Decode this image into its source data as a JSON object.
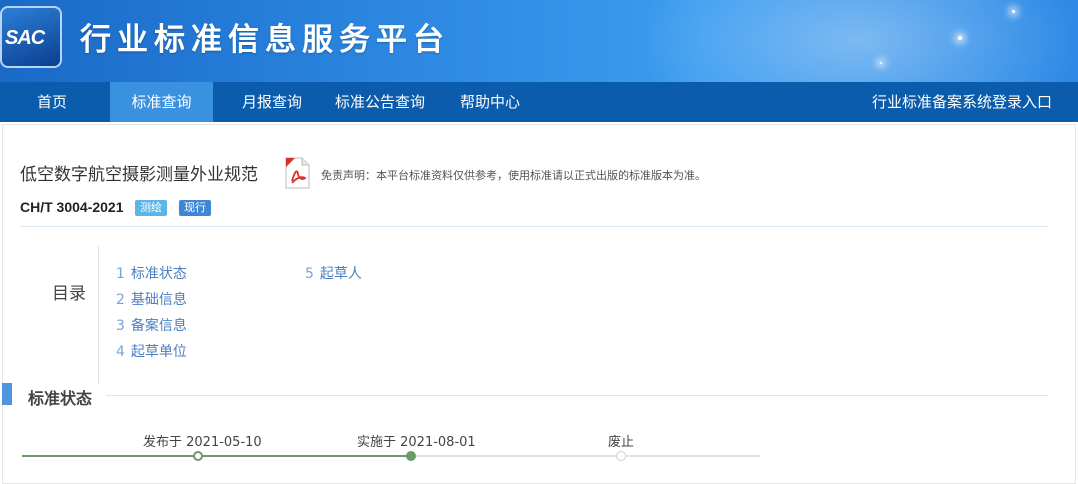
{
  "header": {
    "logo_text": "SAC",
    "site_title": "行业标准信息服务平台"
  },
  "nav": {
    "items": [
      {
        "label": "首页"
      },
      {
        "label": "标准查询"
      },
      {
        "label": "月报查询"
      },
      {
        "label": "标准公告查询"
      },
      {
        "label": "帮助中心"
      }
    ],
    "active": "标准查询",
    "login_label": "行业标准备案系统登录入口"
  },
  "standard": {
    "title": "低空数字航空摄影测量外业规范",
    "code": "CH/T 3004-2021",
    "category_badge": "测绘",
    "status_badge": "现行",
    "pdf_icon": "pdf-icon",
    "disclaimer": "免责声明：本平台标准资料仅供参考，使用标准请以正式出版的标准版本为准。"
  },
  "toc": {
    "label": "目录",
    "items": [
      {
        "num": "1",
        "label": "标准状态"
      },
      {
        "num": "2",
        "label": "基础信息"
      },
      {
        "num": "3",
        "label": "备案信息"
      },
      {
        "num": "4",
        "label": "起草单位"
      },
      {
        "num": "5",
        "label": "起草人"
      }
    ]
  },
  "status_section": {
    "title": "标准状态",
    "timeline": [
      {
        "label": "发布于 2021-05-10",
        "state": "done"
      },
      {
        "label": "实施于 2021-08-01",
        "state": "current"
      },
      {
        "label": "废止",
        "state": "pending"
      }
    ]
  },
  "colors": {
    "header_blue": "#2b86e0",
    "nav_blue": "#0b5cad",
    "nav_active": "#3a91e0",
    "timeline_green": "#6b9a68",
    "badge_category": "#5bb5e8",
    "badge_status": "#3f87d6"
  }
}
